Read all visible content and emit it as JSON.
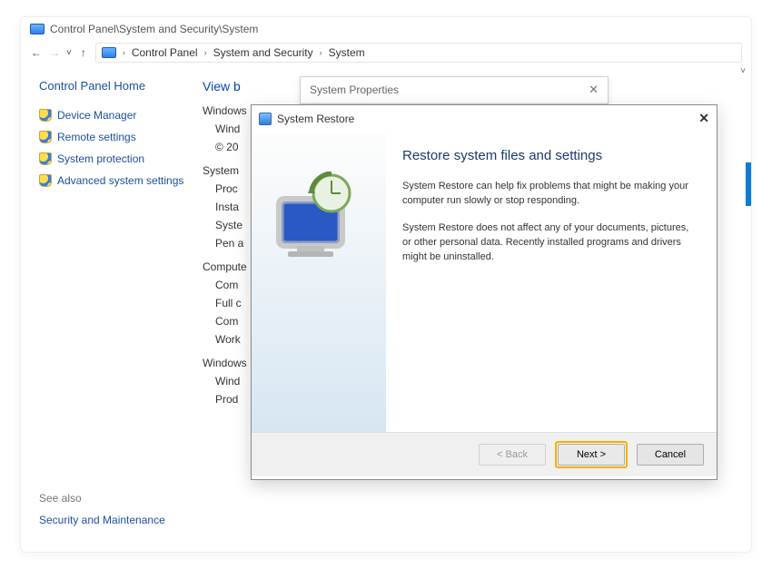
{
  "titlebar": "Control Panel\\System and Security\\System",
  "breadcrumb": {
    "parts": [
      "Control Panel",
      "System and Security",
      "System"
    ]
  },
  "leftnav": {
    "home": "Control Panel Home",
    "items": [
      "Device Manager",
      "Remote settings",
      "System protection",
      "Advanced system settings"
    ]
  },
  "seealso": {
    "header": "See also",
    "link": "Security and Maintenance"
  },
  "content": {
    "viewby": "View b",
    "groups": [
      {
        "header": "Windows",
        "items": [
          "Wind",
          "© 20"
        ]
      },
      {
        "header": "System",
        "items": [
          "Proc",
          "Insta",
          "Syste",
          "Pen a"
        ]
      },
      {
        "header": "Compute",
        "items": [
          "Com",
          "Full c",
          "Com",
          "Work"
        ]
      },
      {
        "header": "Windows",
        "items": [
          "Wind",
          "Prod"
        ]
      }
    ]
  },
  "sysprops": {
    "title": "System Properties"
  },
  "dialog": {
    "title": "System Restore",
    "heading": "Restore system files and settings",
    "para1": "System Restore can help fix problems that might be making your computer run slowly or stop responding.",
    "para2": "System Restore does not affect any of your documents, pictures, or other personal data. Recently installed programs and drivers might be uninstalled.",
    "buttons": {
      "back": "< Back",
      "next": "Next >",
      "cancel": "Cancel"
    }
  }
}
